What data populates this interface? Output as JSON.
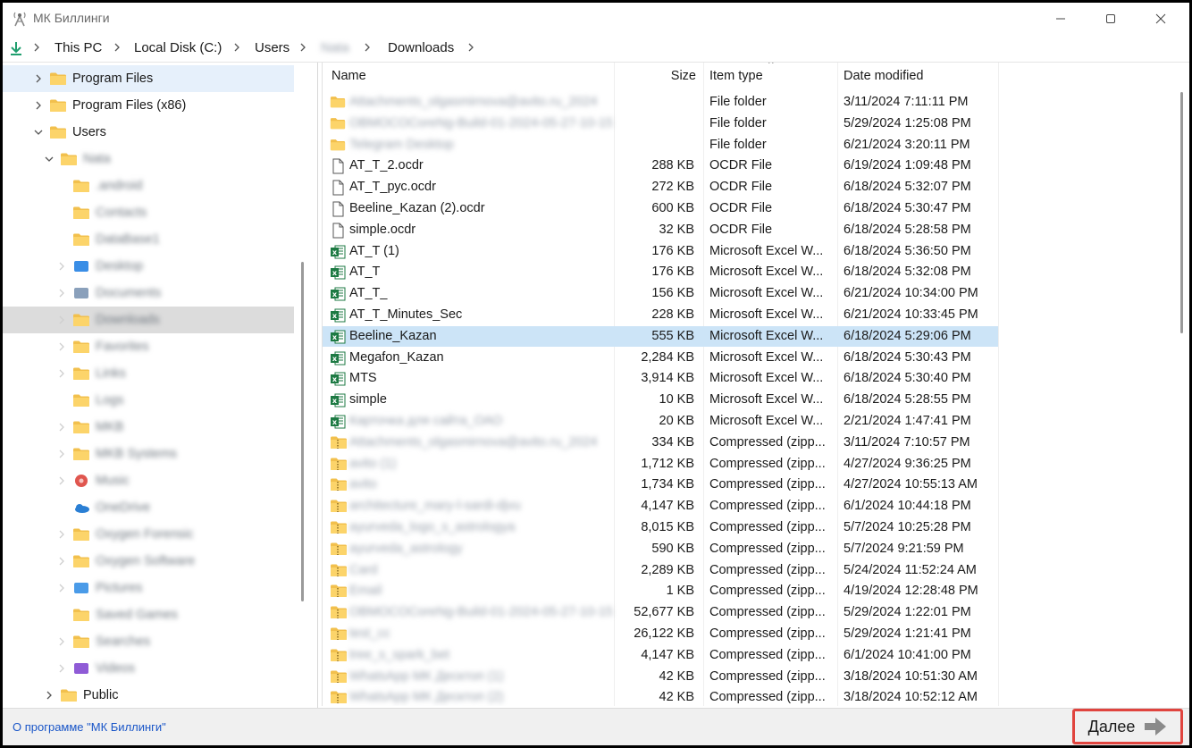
{
  "window": {
    "title": "МК Биллинги"
  },
  "breadcrumb": [
    {
      "label": "This PC",
      "blurred": false
    },
    {
      "label": "Local Disk (C:)",
      "blurred": false
    },
    {
      "label": "Users",
      "blurred": false
    },
    {
      "label": "Nata",
      "blurred": true
    },
    {
      "label": "Downloads",
      "blurred": false
    }
  ],
  "tree": [
    {
      "label": "Program Files",
      "level": 1,
      "expander": "collapsed",
      "icon": "folder-icon",
      "blurred": false,
      "state": "hover"
    },
    {
      "label": "Program Files (x86)",
      "level": 1,
      "expander": "collapsed",
      "icon": "folder-icon",
      "blurred": false,
      "state": ""
    },
    {
      "label": "Users",
      "level": 1,
      "expander": "expanded",
      "icon": "folder-icon",
      "blurred": false,
      "state": ""
    },
    {
      "label": "Nata",
      "level": 2,
      "expander": "expanded",
      "icon": "folder-icon",
      "blurred": true,
      "state": ""
    },
    {
      "label": ".android",
      "level": 3,
      "expander": "none",
      "icon": "folder-icon",
      "blurred": true,
      "state": ""
    },
    {
      "label": "Contacts",
      "level": 3,
      "expander": "none",
      "icon": "folder-icon",
      "blurred": true,
      "state": ""
    },
    {
      "label": "DataBase1",
      "level": 3,
      "expander": "none",
      "icon": "folder-icon",
      "blurred": true,
      "state": ""
    },
    {
      "label": "Desktop",
      "level": 3,
      "expander": "faint",
      "icon": "desktop-icon",
      "blurred": true,
      "state": ""
    },
    {
      "label": "Documents",
      "level": 3,
      "expander": "faint",
      "icon": "documents-icon",
      "blurred": true,
      "state": ""
    },
    {
      "label": "Downloads",
      "level": 3,
      "expander": "faint",
      "icon": "download-folder-icon",
      "blurred": true,
      "state": "selected"
    },
    {
      "label": "Favorites",
      "level": 3,
      "expander": "faint",
      "icon": "folder-icon",
      "blurred": true,
      "state": ""
    },
    {
      "label": "Links",
      "level": 3,
      "expander": "faint",
      "icon": "folder-icon",
      "blurred": true,
      "state": ""
    },
    {
      "label": "Logs",
      "level": 3,
      "expander": "none",
      "icon": "folder-icon",
      "blurred": true,
      "state": ""
    },
    {
      "label": "MKB",
      "level": 3,
      "expander": "faint",
      "icon": "folder-icon",
      "blurred": true,
      "state": ""
    },
    {
      "label": "MKB Systems",
      "level": 3,
      "expander": "faint",
      "icon": "folder-icon",
      "blurred": true,
      "state": ""
    },
    {
      "label": "Music",
      "level": 3,
      "expander": "faint",
      "icon": "music-icon",
      "blurred": true,
      "state": ""
    },
    {
      "label": "OneDrive",
      "level": 3,
      "expander": "none",
      "icon": "cloud-icon",
      "blurred": true,
      "state": ""
    },
    {
      "label": "Oxygen Forensic",
      "level": 3,
      "expander": "faint",
      "icon": "folder-icon",
      "blurred": true,
      "state": ""
    },
    {
      "label": "Oxygen Software",
      "level": 3,
      "expander": "faint",
      "icon": "folder-icon",
      "blurred": true,
      "state": ""
    },
    {
      "label": "Pictures",
      "level": 3,
      "expander": "faint",
      "icon": "pictures-icon",
      "blurred": true,
      "state": ""
    },
    {
      "label": "Saved Games",
      "level": 3,
      "expander": "none",
      "icon": "folder-icon",
      "blurred": true,
      "state": ""
    },
    {
      "label": "Searches",
      "level": 3,
      "expander": "faint",
      "icon": "folder-icon",
      "blurred": true,
      "state": ""
    },
    {
      "label": "Videos",
      "level": 3,
      "expander": "faint",
      "icon": "videos-icon",
      "blurred": true,
      "state": ""
    },
    {
      "label": "Public",
      "level": 2,
      "expander": "collapsed",
      "icon": "folder-icon",
      "blurred": false,
      "state": ""
    }
  ],
  "list": {
    "columns": {
      "name": "Name",
      "size": "Size",
      "type": "Item type",
      "date": "Date modified"
    },
    "sort_indicator": "^",
    "rows": [
      {
        "name": "Attachments_olgasmirnova@avito.ru_2024",
        "size": "",
        "type": "File folder",
        "date": "3/11/2024 7:11:11 PM",
        "icon": "folder",
        "blurred": true,
        "selected": false
      },
      {
        "name": "OBMOCOCoreNg-Build-01-2024-05-27-10-15-36",
        "size": "",
        "type": "File folder",
        "date": "5/29/2024 1:25:08 PM",
        "icon": "folder",
        "blurred": true,
        "selected": false
      },
      {
        "name": "Telegram Desktop",
        "size": "",
        "type": "File folder",
        "date": "6/21/2024 3:20:11 PM",
        "icon": "folder",
        "blurred": true,
        "selected": false
      },
      {
        "name": "AT_T_2.ocdr",
        "size": "288 KB",
        "type": "OCDR File",
        "date": "6/19/2024 1:09:48 PM",
        "icon": "file",
        "blurred": false,
        "selected": false
      },
      {
        "name": "AT_T_рус.ocdr",
        "size": "272 KB",
        "type": "OCDR File",
        "date": "6/18/2024 5:32:07 PM",
        "icon": "file",
        "blurred": false,
        "selected": false
      },
      {
        "name": "Beeline_Kazan (2).ocdr",
        "size": "600 KB",
        "type": "OCDR File",
        "date": "6/18/2024 5:30:47 PM",
        "icon": "file",
        "blurred": false,
        "selected": false
      },
      {
        "name": "simple.ocdr",
        "size": "32 KB",
        "type": "OCDR File",
        "date": "6/18/2024 5:28:58 PM",
        "icon": "file",
        "blurred": false,
        "selected": false
      },
      {
        "name": "AT_T (1)",
        "size": "176 KB",
        "type": "Microsoft Excel W...",
        "date": "6/18/2024 5:36:50 PM",
        "icon": "excel",
        "blurred": false,
        "selected": false
      },
      {
        "name": "AT_T",
        "size": "176 KB",
        "type": "Microsoft Excel W...",
        "date": "6/18/2024 5:32:08 PM",
        "icon": "excel",
        "blurred": false,
        "selected": false
      },
      {
        "name": "AT_T_",
        "size": "156 KB",
        "type": "Microsoft Excel W...",
        "date": "6/21/2024 10:34:00 PM",
        "icon": "excel",
        "blurred": false,
        "selected": false
      },
      {
        "name": "AT_T_Minutes_Sec",
        "size": "228 KB",
        "type": "Microsoft Excel W...",
        "date": "6/21/2024 10:33:45 PM",
        "icon": "excel",
        "blurred": false,
        "selected": false
      },
      {
        "name": "Beeline_Kazan",
        "size": "555 KB",
        "type": "Microsoft Excel W...",
        "date": "6/18/2024 5:29:06 PM",
        "icon": "excel",
        "blurred": false,
        "selected": true
      },
      {
        "name": "Megafon_Kazan",
        "size": "2,284 KB",
        "type": "Microsoft Excel W...",
        "date": "6/18/2024 5:30:43 PM",
        "icon": "excel",
        "blurred": false,
        "selected": false
      },
      {
        "name": "MTS",
        "size": "3,914 KB",
        "type": "Microsoft Excel W...",
        "date": "6/18/2024 5:30:40 PM",
        "icon": "excel",
        "blurred": false,
        "selected": false
      },
      {
        "name": "simple",
        "size": "10 KB",
        "type": "Microsoft Excel W...",
        "date": "6/18/2024 5:28:55 PM",
        "icon": "excel",
        "blurred": false,
        "selected": false
      },
      {
        "name": "Карточка для сайта_ОАО",
        "size": "20 KB",
        "type": "Microsoft Excel W...",
        "date": "2/21/2024 1:47:41 PM",
        "icon": "excel",
        "blurred": true,
        "selected": false
      },
      {
        "name": "Attachments_olgasmirnova@avito.ru_2024",
        "size": "334 KB",
        "type": "Compressed (zipp...",
        "date": "3/11/2024 7:10:57 PM",
        "icon": "zip",
        "blurred": true,
        "selected": false
      },
      {
        "name": "avito (1)",
        "size": "1,712 KB",
        "type": "Compressed (zipp...",
        "date": "4/27/2024 9:36:25 PM",
        "icon": "zip",
        "blurred": true,
        "selected": false
      },
      {
        "name": "avito",
        "size": "1,734 KB",
        "type": "Compressed (zipp...",
        "date": "4/27/2024 10:55:13 AM",
        "icon": "zip",
        "blurred": true,
        "selected": false
      },
      {
        "name": "architecture_mary-l-sardi-djvu",
        "size": "4,147 KB",
        "type": "Compressed (zipp...",
        "date": "6/1/2024 10:44:18 PM",
        "icon": "zip",
        "blurred": true,
        "selected": false
      },
      {
        "name": "ayurveda_logo_s_astrologya",
        "size": "8,015 KB",
        "type": "Compressed (zipp...",
        "date": "5/7/2024 10:25:28 PM",
        "icon": "zip",
        "blurred": true,
        "selected": false
      },
      {
        "name": "ayurveda_astrology",
        "size": "590 KB",
        "type": "Compressed (zipp...",
        "date": "5/7/2024 9:21:59 PM",
        "icon": "zip",
        "blurred": true,
        "selected": false
      },
      {
        "name": "Card",
        "size": "2,289 KB",
        "type": "Compressed (zipp...",
        "date": "5/24/2024 11:52:24 AM",
        "icon": "zip",
        "blurred": true,
        "selected": false
      },
      {
        "name": "Email",
        "size": "1 KB",
        "type": "Compressed (zipp...",
        "date": "4/19/2024 12:28:48 PM",
        "icon": "zip",
        "blurred": true,
        "selected": false
      },
      {
        "name": "OBMOCOCoreNg-Build-01-2024-05-27-10-15-36",
        "size": "52,677 KB",
        "type": "Compressed (zipp...",
        "date": "5/29/2024 1:22:01 PM",
        "icon": "zip",
        "blurred": true,
        "selected": false
      },
      {
        "name": "test_cc",
        "size": "26,122 KB",
        "type": "Compressed (zipp...",
        "date": "5/29/2024 1:21:41 PM",
        "icon": "zip",
        "blurred": true,
        "selected": false
      },
      {
        "name": "tree_s_spark_bet",
        "size": "4,147 KB",
        "type": "Compressed (zipp...",
        "date": "6/1/2024 10:41:00 PM",
        "icon": "zip",
        "blurred": true,
        "selected": false
      },
      {
        "name": "WhatsApp MK Десктоп (1)",
        "size": "42 KB",
        "type": "Compressed (zipp...",
        "date": "3/18/2024 10:51:30 AM",
        "icon": "zip",
        "blurred": true,
        "selected": false
      },
      {
        "name": "WhatsApp MK Десктоп (2)",
        "size": "42 KB",
        "type": "Compressed (zipp...",
        "date": "3/18/2024 10:52:12 AM",
        "icon": "zip",
        "blurred": true,
        "selected": false
      }
    ]
  },
  "footer": {
    "about_label": "О программе \"МК Биллинги\"",
    "next_label": "Далее"
  }
}
